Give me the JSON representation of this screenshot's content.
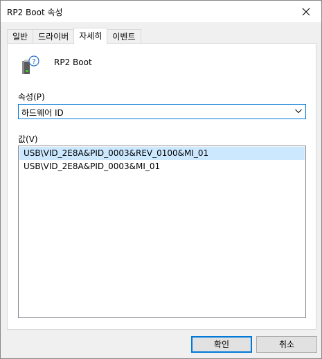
{
  "window": {
    "title": "RP2 Boot 속성"
  },
  "tabs": [
    {
      "label": "일반"
    },
    {
      "label": "드라이버"
    },
    {
      "label": "자세히",
      "active": true
    },
    {
      "label": "이벤트"
    }
  ],
  "device": {
    "name": "RP2 Boot",
    "icon": "usb-device-unknown-icon"
  },
  "property": {
    "label": "속성(P)",
    "selected": "하드웨어 ID"
  },
  "value": {
    "label": "값(V)",
    "items": [
      "USB\\VID_2E8A&PID_0003&REV_0100&MI_01",
      "USB\\VID_2E8A&PID_0003&MI_01"
    ]
  },
  "buttons": {
    "ok": "확인",
    "cancel": "취소"
  },
  "colors": {
    "accent": "#0078d7",
    "selection": "#cce8ff"
  }
}
